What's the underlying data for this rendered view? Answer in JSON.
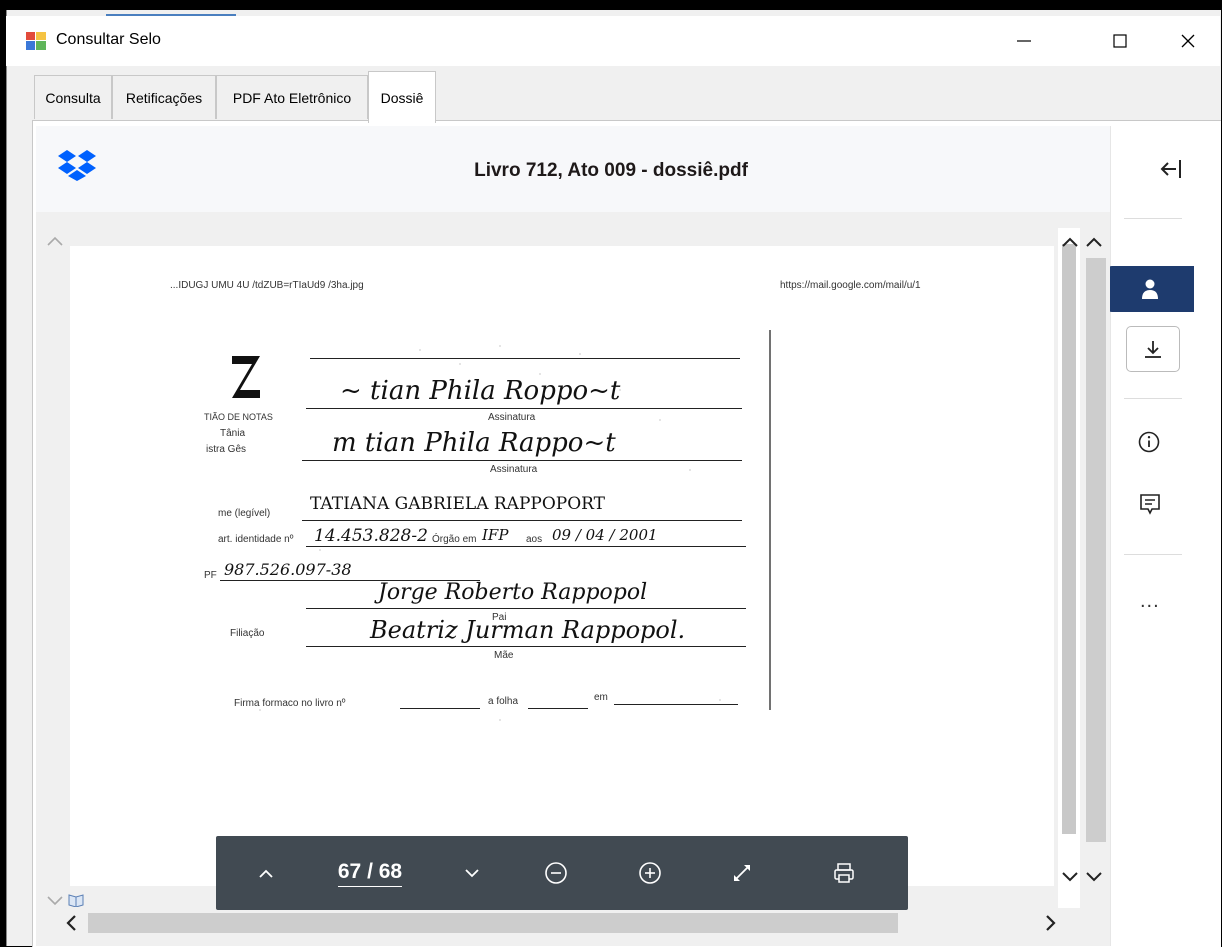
{
  "window": {
    "title": "Consultar Selo",
    "controls": {
      "minimize": "—",
      "maximize": "☐",
      "close": "✕"
    }
  },
  "tabs": [
    {
      "label": "Consulta",
      "active": false
    },
    {
      "label": "Retificações",
      "active": false
    },
    {
      "label": "PDF Ato Eletrônico",
      "active": false
    },
    {
      "label": "Dossiê",
      "active": true
    }
  ],
  "viewer": {
    "file_name": "Livro 712, Ato 009 - dossiê.pdf",
    "logo_icon": "dropbox-icon",
    "rail": {
      "collapse_icon": "collapse-panel-icon",
      "items": [
        "person-icon",
        "download-icon",
        "info-icon",
        "comment-icon",
        "more-icon"
      ],
      "more_label": "..."
    },
    "toolbar": {
      "page_indicator": "67 / 68",
      "prev_icon": "chevron-up-icon",
      "next_icon": "chevron-down-icon",
      "zoom_out_icon": "zoom-out-icon",
      "zoom_in_icon": "zoom-in-icon",
      "fullscreen_icon": "fullscreen-icon",
      "print_icon": "print-icon"
    },
    "accent_color": "#1e3b6e"
  },
  "document": {
    "header_left": "...IDUGJ UMU 4U /tdZUB=rTIaUd9 /3ha.jpg",
    "header_right": "https://mail.google.com/mail/u/1",
    "logo_lines": [
      "TIÃO DE NOTAS",
      "Tânia",
      "istra Gês"
    ],
    "label_assinatura_1": "Assinatura",
    "label_assinatura_2": "Assinatura",
    "label_nome": "me (legível)",
    "value_nome": "TATIANA   GABRIELA   RAPPOPORT",
    "label_ident": "art. identidade nº",
    "value_ident": "14.453.828-2",
    "label_orgao": "Órgão em",
    "value_orgao": "IFP",
    "label_data": "aos",
    "value_data": "09 / 04 / 2001",
    "label_cpf": "PF",
    "value_cpf": "987.526.097-38",
    "label_filiacao": "Filiação",
    "label_pai": "Pai",
    "label_mae": "Mãe",
    "label_firma": "Firma formaco no livro nº",
    "label_folha": "a folha",
    "label_em": "em"
  }
}
